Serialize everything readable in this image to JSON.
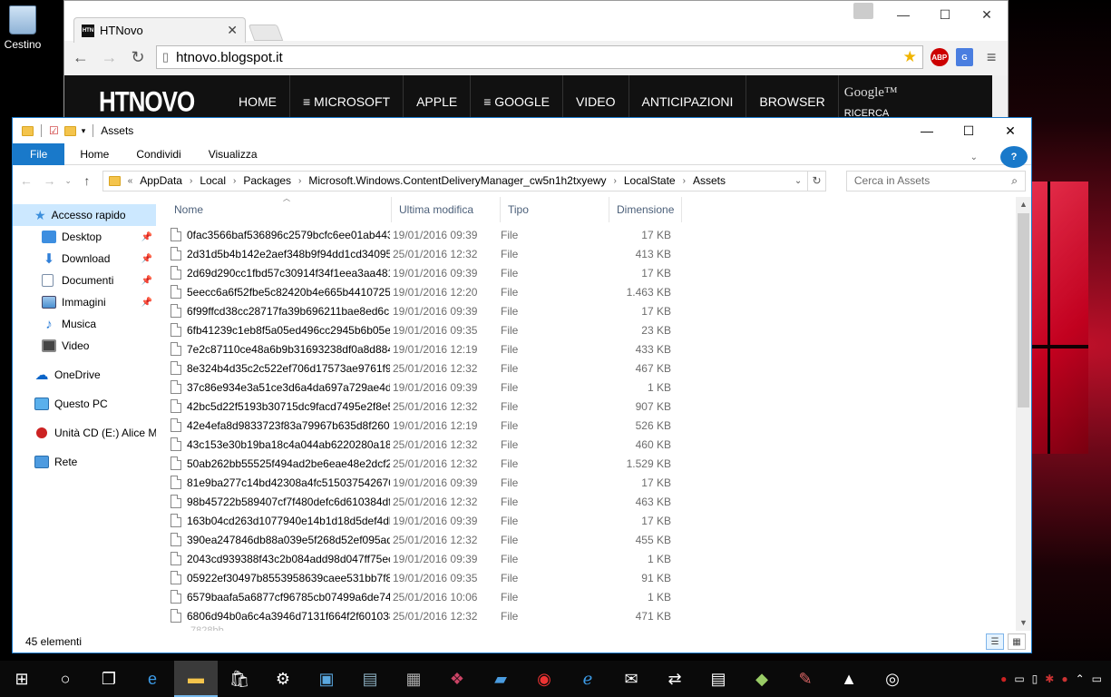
{
  "desktop": {
    "recycle_bin_label": "Cestino"
  },
  "browser": {
    "tab_title": "HTNovo",
    "tab_favicon_text": "HTN",
    "tab_close": "✕",
    "url": "htnovo.blogspot.it",
    "ext_adblock_label": "ABP",
    "ext_translate_label": "G",
    "site": {
      "logo": "HTNOVO",
      "nav": [
        "HOME",
        "≡ MICROSOFT",
        "APPLE",
        "≡ GOOGLE",
        "VIDEO",
        "ANTICIPAZIONI",
        "BROWSER"
      ],
      "google_text": "Google™",
      "ricerca": "RICERCA"
    }
  },
  "explorer": {
    "title": "Assets",
    "ribbon_tabs": [
      "File",
      "Home",
      "Condividi",
      "Visualizza"
    ],
    "breadcrumb": [
      "AppData",
      "Local",
      "Packages",
      "Microsoft.Windows.ContentDeliveryManager_cw5n1h2txyewy",
      "LocalState",
      "Assets"
    ],
    "search_placeholder": "Cerca in Assets",
    "sidebar": {
      "quick_access": "Accesso rapido",
      "quick_items": [
        "Desktop",
        "Download",
        "Documenti",
        "Immagini",
        "Musica",
        "Video"
      ],
      "onedrive": "OneDrive",
      "this_pc": "Questo PC",
      "cd_drive": "Unità CD (E:) Alice M",
      "network": "Rete"
    },
    "columns": [
      "Nome",
      "Ultima modifica",
      "Tipo",
      "Dimensione"
    ],
    "files": [
      [
        "0fac3566baf536896c2579bcfc6ee01ab443...",
        "19/01/2016 09:39",
        "File",
        "17 KB"
      ],
      [
        "2d31d5b4b142e2aef348b9f94dd1cd34095...",
        "25/01/2016 12:32",
        "File",
        "413 KB"
      ],
      [
        "2d69d290cc1fbd57c30914f34f1eea3aa481...",
        "19/01/2016 09:39",
        "File",
        "17 KB"
      ],
      [
        "5eecc6a6f52fbe5c82420b4e665b44107253...",
        "19/01/2016 12:20",
        "File",
        "1.463 KB"
      ],
      [
        "6f99ffcd38cc28717fa39b696211bae8ed6c...",
        "19/01/2016 09:39",
        "File",
        "17 KB"
      ],
      [
        "6fb41239c1eb8f5a05ed496cc2945b6b05e9...",
        "19/01/2016 09:35",
        "File",
        "23 KB"
      ],
      [
        "7e2c87110ce48a6b9b31693238df0a8d884...",
        "19/01/2016 12:19",
        "File",
        "433 KB"
      ],
      [
        "8e324b4d35c2c522ef706d17573ae9761f91...",
        "25/01/2016 12:32",
        "File",
        "467 KB"
      ],
      [
        "37c86e934e3a51ce3d6a4da697a729ae4de...",
        "19/01/2016 09:39",
        "File",
        "1 KB"
      ],
      [
        "42bc5d22f5193b30715dc9facd7495e2f8e5...",
        "25/01/2016 12:32",
        "File",
        "907 KB"
      ],
      [
        "42e4efa8d9833723f83a79967b635d8f260a...",
        "19/01/2016 12:19",
        "File",
        "526 KB"
      ],
      [
        "43c153e30b19ba18c4a044ab6220280a18f7...",
        "25/01/2016 12:32",
        "File",
        "460 KB"
      ],
      [
        "50ab262bb55525f494ad2be6eae48e2dcf2...",
        "25/01/2016 12:32",
        "File",
        "1.529 KB"
      ],
      [
        "81e9ba277c14bd42308a4fc5150375426709...",
        "19/01/2016 09:39",
        "File",
        "17 KB"
      ],
      [
        "98b45722b589407cf7f480defc6d610384df...",
        "25/01/2016 12:32",
        "File",
        "463 KB"
      ],
      [
        "163b04cd263d1077940e14b1d18d5def4db...",
        "19/01/2016 09:39",
        "File",
        "17 KB"
      ],
      [
        "390ea247846db88a039e5f268d52ef095ad4...",
        "25/01/2016 12:32",
        "File",
        "455 KB"
      ],
      [
        "2043cd939388f43c2b084add98d047ff75ec...",
        "19/01/2016 09:39",
        "File",
        "1 KB"
      ],
      [
        "05922ef30497b8553958639caee531bb7f80...",
        "19/01/2016 09:35",
        "File",
        "91 KB"
      ],
      [
        "6579baafa5a6877cf96785cb07499a6de740...",
        "25/01/2016 10:06",
        "File",
        "1 KB"
      ],
      [
        "6806d94b0a6c4a3946d7131f664f2f601038f...",
        "25/01/2016 12:32",
        "File",
        "471 KB"
      ]
    ],
    "status": "45 elementi"
  }
}
